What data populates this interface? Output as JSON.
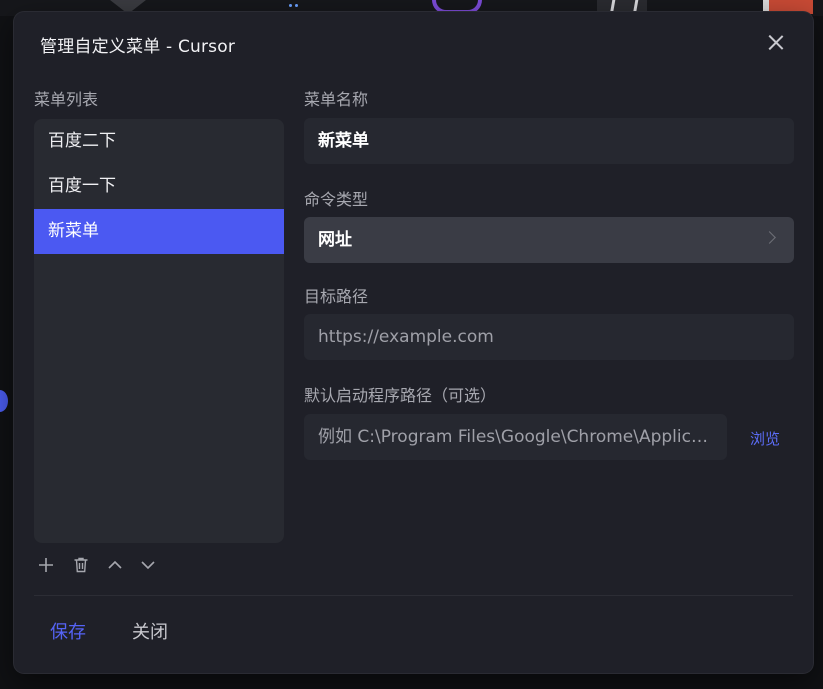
{
  "dialog": {
    "title": "管理自定义菜单 - Cursor"
  },
  "menu_list": {
    "label": "菜单列表",
    "items": [
      {
        "label": "百度二下",
        "selected": false
      },
      {
        "label": "百度一下",
        "selected": false
      },
      {
        "label": "新菜单",
        "selected": true
      }
    ],
    "tools": {
      "add_icon": "plus-icon",
      "delete_icon": "trash-icon",
      "up_icon": "chevron-up-icon",
      "down_icon": "chevron-down-icon"
    }
  },
  "form": {
    "name_label": "菜单名称",
    "name_value": "新菜单",
    "type_label": "命令类型",
    "type_value": "网址",
    "target_label": "目标路径",
    "target_placeholder": "https://example.com",
    "launcher_label": "默认启动程序路径（可选）",
    "launcher_placeholder": "例如 C:\\Program Files\\Google\\Chrome\\Application\\chrome.exe",
    "browse_label": "浏览"
  },
  "footer": {
    "save_label": "保存",
    "close_label": "关闭"
  },
  "colors": {
    "accent": "#4b59f2",
    "dialog_bg": "#1f2028",
    "panel_bg": "#282a31"
  }
}
